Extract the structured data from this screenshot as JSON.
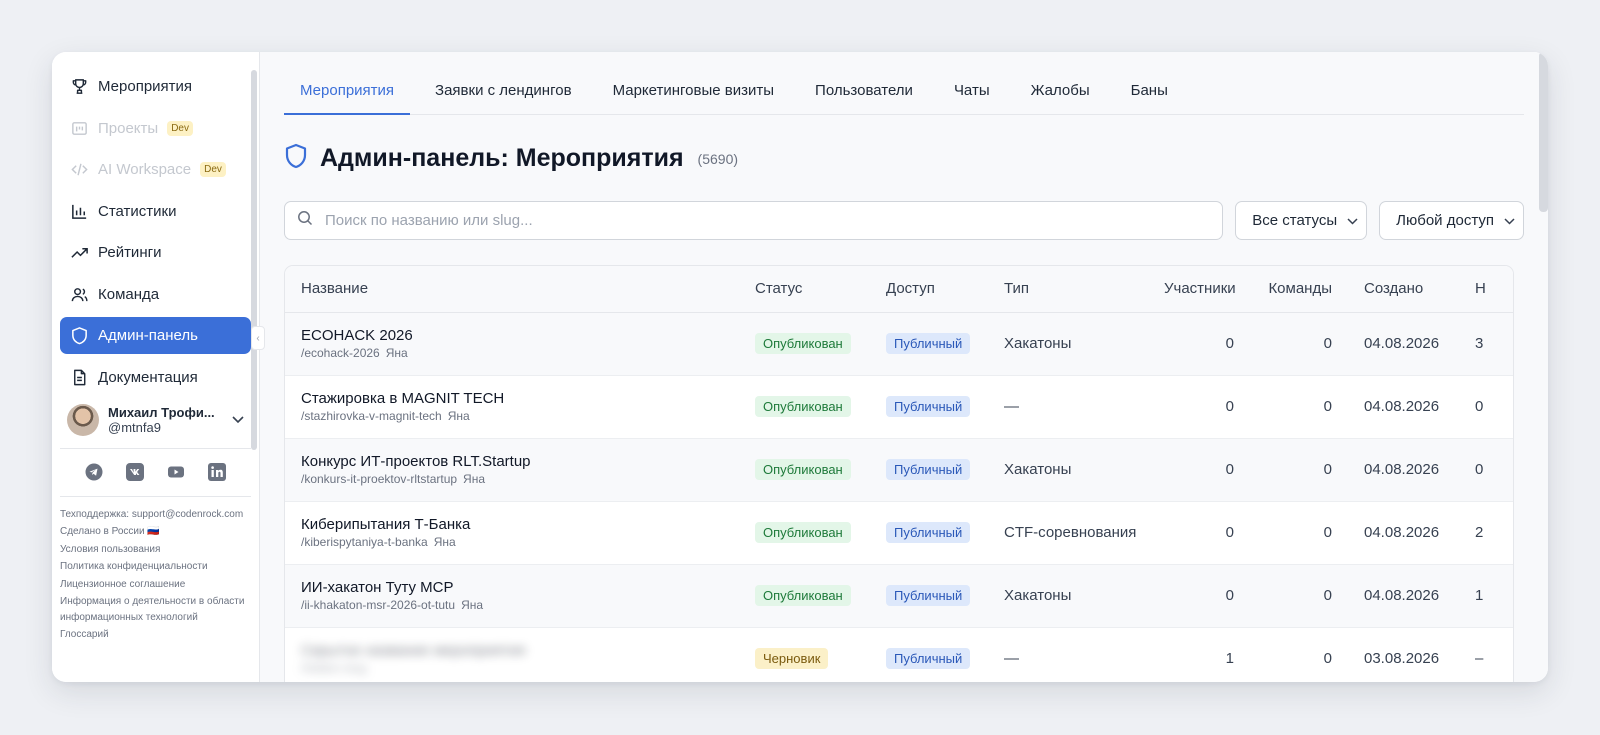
{
  "sidebar": {
    "items": [
      {
        "label": "Мероприятия",
        "icon": "trophy-icon",
        "state": "normal"
      },
      {
        "label": "Проекты",
        "icon": "projects-icon",
        "state": "disabled",
        "badge": "Dev"
      },
      {
        "label": "AI Workspace",
        "icon": "code-icon",
        "state": "disabled",
        "badge": "Dev"
      },
      {
        "label": "Статистики",
        "icon": "bar-chart-icon",
        "state": "normal"
      },
      {
        "label": "Рейтинги",
        "icon": "trending-up-icon",
        "state": "normal"
      },
      {
        "label": "Команда",
        "icon": "users-icon",
        "state": "normal"
      },
      {
        "label": "Админ-панель",
        "icon": "shield-icon",
        "state": "active"
      },
      {
        "label": "Документация",
        "icon": "document-icon",
        "state": "normal"
      }
    ],
    "user": {
      "name": "Михаил Трофи...",
      "handle": "@mtnfa9"
    },
    "socials": [
      "telegram-icon",
      "vk-icon",
      "youtube-icon",
      "linkedin-icon"
    ],
    "footer": [
      "Техподдержка: support@codenrock.com",
      "Сделано в России 🇷🇺",
      "Условия пользования",
      "Политика конфиденциальности",
      "Лицензионное соглашение",
      "Информация о деятельности в области информационных технологий",
      "Глоссарий"
    ]
  },
  "tabs": [
    "Мероприятия",
    "Заявки с лендингов",
    "Маркетинговые визиты",
    "Пользователи",
    "Чаты",
    "Жалобы",
    "Баны"
  ],
  "active_tab": 0,
  "page": {
    "title": "Админ-панель: Мероприятия",
    "count": "(5690)"
  },
  "search": {
    "placeholder": "Поиск по названию или slug..."
  },
  "filters": {
    "status": "Все статусы",
    "access": "Любой доступ"
  },
  "table": {
    "columns": [
      "Название",
      "Статус",
      "Доступ",
      "Тип",
      "Участники",
      "Команды",
      "Создано",
      "Н"
    ],
    "rows": [
      {
        "name": "ECOHACK 2026",
        "slug": "/ecohack-2026",
        "author": "Яна",
        "status": "Опубликован",
        "access": "Публичный",
        "type": "Хакатоны",
        "participants": "0",
        "teams": "0",
        "created": "04.08.2026",
        "extra": "3"
      },
      {
        "name": "Стажировка в MAGNIT TECH",
        "slug": "/stazhirovka-v-magnit-tech",
        "author": "Яна",
        "status": "Опубликован",
        "access": "Публичный",
        "type": "—",
        "participants": "0",
        "teams": "0",
        "created": "04.08.2026",
        "extra": "0"
      },
      {
        "name": "Конкурс ИТ-проектов RLT.Startup",
        "slug": "/konkurs-it-proektov-rltstartup",
        "author": "Яна",
        "status": "Опубликован",
        "access": "Публичный",
        "type": "Хакатоны",
        "participants": "0",
        "teams": "0",
        "created": "04.08.2026",
        "extra": "0"
      },
      {
        "name": "Киберипытания Т-Банка",
        "slug": "/kiberispytaniya-t-banka",
        "author": "Яна",
        "status": "Опубликован",
        "access": "Публичный",
        "type": "CTF-соревнования",
        "participants": "0",
        "teams": "0",
        "created": "04.08.2026",
        "extra": "2"
      },
      {
        "name": "ИИ-хакатон Туту МСР",
        "slug": "/ii-khakaton-msr-2026-ot-tutu",
        "author": "Яна",
        "status": "Опубликован",
        "access": "Публичный",
        "type": "Хакатоны",
        "participants": "0",
        "teams": "0",
        "created": "04.08.2026",
        "extra": "1"
      },
      {
        "name": "Скрытое название мероприятия",
        "slug": "/hidden-slug",
        "author": "",
        "status": "Черновик",
        "access": "Публичный",
        "type": "—",
        "participants": "1",
        "teams": "0",
        "created": "03.08.2026",
        "extra": "–",
        "blurred": true
      }
    ]
  },
  "colors": {
    "accent": "#3b6fd8",
    "published": "#1e7a3a",
    "draft": "#7a5a0e"
  }
}
